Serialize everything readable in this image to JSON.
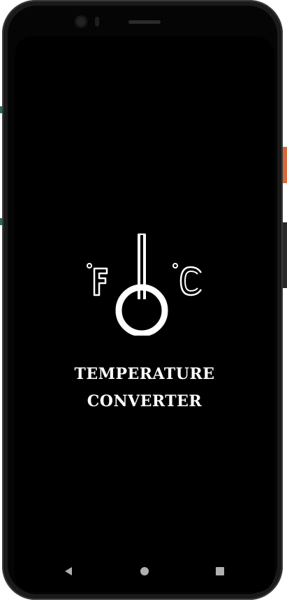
{
  "app": {
    "title_line1": "TEMPERATURE",
    "title_line2": "CONVERTER"
  },
  "logo": {
    "fahrenheit_label": "°F",
    "celsius_label": "°C",
    "icon": "thermometer-icon"
  },
  "nav_bar": {
    "back_icon": "back-triangle-icon",
    "home_icon": "home-circle-icon",
    "recents_icon": "recents-square-icon"
  },
  "colors": {
    "background": "#000000",
    "foreground": "#ffffff",
    "nav_icon": "#b0b0b0"
  }
}
